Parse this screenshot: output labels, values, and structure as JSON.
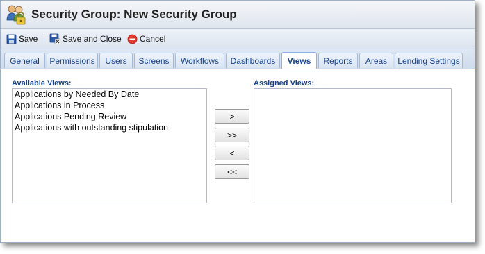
{
  "window": {
    "title": "Security Group: New Security Group"
  },
  "toolbar": {
    "save_label": "Save",
    "save_close_label": "Save and Close",
    "cancel_label": "Cancel"
  },
  "tabs": [
    {
      "label": "General",
      "active": false
    },
    {
      "label": "Permissions",
      "active": false
    },
    {
      "label": "Users",
      "active": false
    },
    {
      "label": "Screens",
      "active": false
    },
    {
      "label": "Workflows",
      "active": false
    },
    {
      "label": "Dashboards",
      "active": false
    },
    {
      "label": "Views",
      "active": true
    },
    {
      "label": "Reports",
      "active": false
    },
    {
      "label": "Areas",
      "active": false
    },
    {
      "label": "Lending Settings",
      "active": false
    }
  ],
  "available": {
    "label": "Available Views:",
    "items": [
      "Applications by Needed By Date",
      "Applications in Process",
      "Applications Pending Review",
      "Applications with outstanding stipulation"
    ]
  },
  "assigned": {
    "label": "Assigned Views:",
    "items": []
  },
  "move_buttons": {
    "move_right": ">",
    "move_all_right": ">>",
    "move_left": "<",
    "move_all_left": "<<"
  },
  "colors": {
    "tab_text": "#15428b",
    "label_text": "#15428b",
    "tab_border": "#99bbe8"
  }
}
